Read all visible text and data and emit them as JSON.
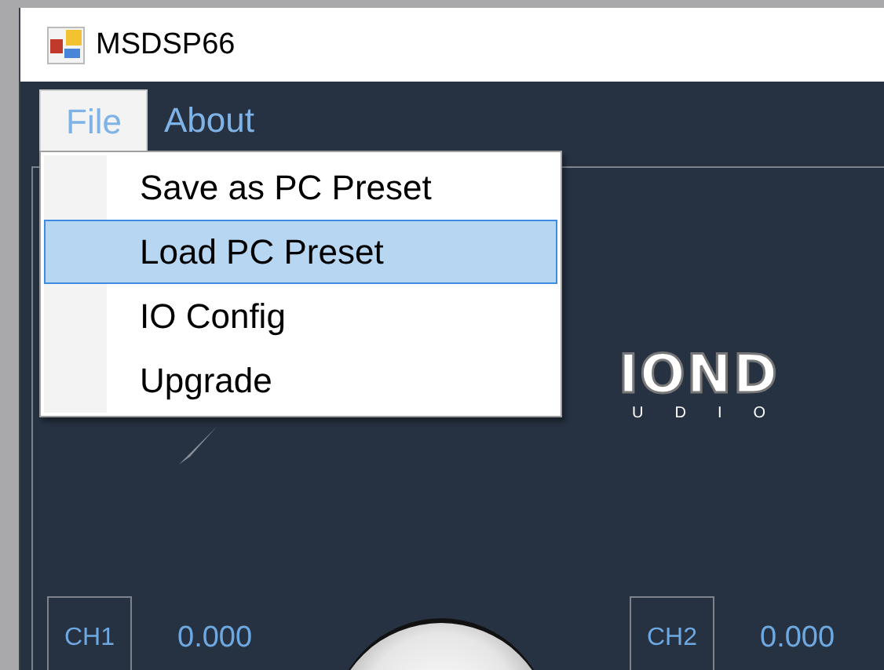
{
  "window": {
    "title": "MSDSP66"
  },
  "menu_bar": [
    {
      "label": "File",
      "selected": true
    },
    {
      "label": "About",
      "selected": false
    }
  ],
  "file_menu": {
    "items": [
      {
        "label": "Save as PC Preset",
        "selected": false
      },
      {
        "label": "Load PC Preset",
        "selected": true
      },
      {
        "label": "IO Config",
        "selected": false
      },
      {
        "label": "Upgrade",
        "selected": false
      }
    ]
  },
  "logo": {
    "text": "IOND",
    "subtitle": "UDIO"
  },
  "channels": [
    {
      "label": "CH1",
      "value": "0.000"
    },
    {
      "label": "CH2",
      "value": "0.000"
    }
  ]
}
